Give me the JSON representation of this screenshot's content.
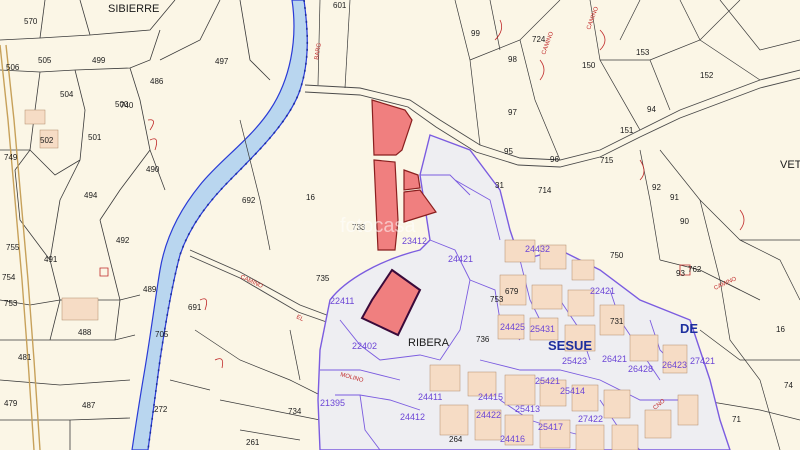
{
  "map": {
    "colors": {
      "background": "#fbf6e6",
      "river": "#b9d6ef",
      "river_edge": "#2a3bd6",
      "parcel_line": "#3a3a3a",
      "urban_fill": "#eeeef2",
      "urban_line": "#7b5ce0",
      "highlight": "#f07f7f",
      "building": "#f6dcc5",
      "red_marks": "#c02a2a"
    },
    "place_names": {
      "sibierre": "SIBIERRE",
      "ribera": "RIBERA",
      "sesue": "SESUE",
      "de": "DE",
      "vet": "VET"
    },
    "road_labels": {
      "camino_1": "CAMINO",
      "camino_2": "CAMINO",
      "camino_3": "CAMINO",
      "camino_4": "CAMINO",
      "molino": "MOLINO",
      "el": "EL",
      "barg": "BARG",
      "cno": "CNO"
    },
    "parcels": [
      "570",
      "505",
      "499",
      "504",
      "486",
      "500",
      "501",
      "502",
      "494",
      "490",
      "492",
      "491",
      "489",
      "488",
      "481",
      "487",
      "479",
      "497",
      "692",
      "691",
      "16",
      "705",
      "733",
      "735",
      "272",
      "734",
      "261",
      "264",
      "601",
      "99",
      "98",
      "97",
      "96",
      "95",
      "150",
      "153",
      "152",
      "94",
      "151",
      "715",
      "31",
      "714",
      "92",
      "91",
      "90",
      "93",
      "750",
      "762",
      "736",
      "679",
      "753",
      "731",
      "71",
      "74",
      "16",
      "740",
      "755",
      "754",
      "753",
      "749",
      "506",
      "724"
    ],
    "urban_parcels": [
      "23412",
      "22411",
      "24421",
      "24432",
      "22402",
      "21395",
      "24411",
      "24415",
      "24425",
      "25431",
      "25421",
      "25413",
      "25414",
      "24416",
      "24412",
      "26421",
      "26428",
      "26423",
      "27421",
      "27422",
      "25423",
      "24422",
      "25417",
      "22421"
    ],
    "watermark": "fotocasa"
  }
}
